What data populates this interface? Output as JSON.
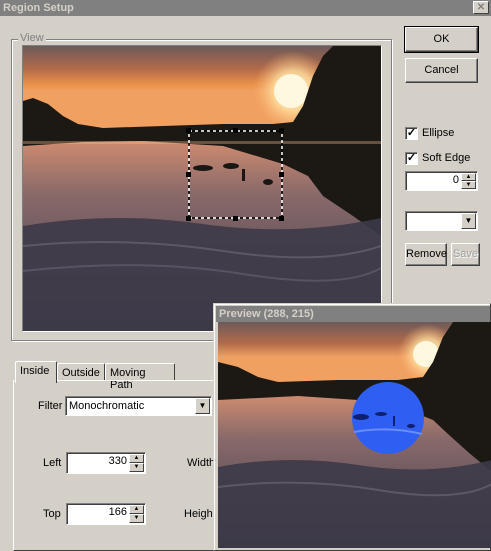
{
  "window": {
    "title": "Region Setup",
    "close_glyph": "✕"
  },
  "buttons": {
    "ok": "OK",
    "cancel": "Cancel",
    "remove": "Remove",
    "save": "Save"
  },
  "view": {
    "label": "View"
  },
  "options": {
    "ellipse": {
      "label": "Ellipse",
      "checked": true
    },
    "soft_edge": {
      "label": "Soft Edge",
      "checked": true
    },
    "edge_value": "0",
    "region_select": ""
  },
  "tabs": [
    {
      "label": "Inside",
      "active": true
    },
    {
      "label": "Outside",
      "active": false
    },
    {
      "label": "Moving Path",
      "active": false
    }
  ],
  "inside": {
    "filter_label": "Filter",
    "filter_value": "Monochromatic",
    "left_label": "Left",
    "left_value": "330",
    "top_label": "Top",
    "top_value": "166",
    "width_label": "Width",
    "height_label": "Height"
  },
  "preview": {
    "title": "Preview (288, 215)"
  },
  "colors": {
    "sky_top": "#6e5a5a",
    "sun": "#fff6d0",
    "mask": "#2f5ff2"
  }
}
